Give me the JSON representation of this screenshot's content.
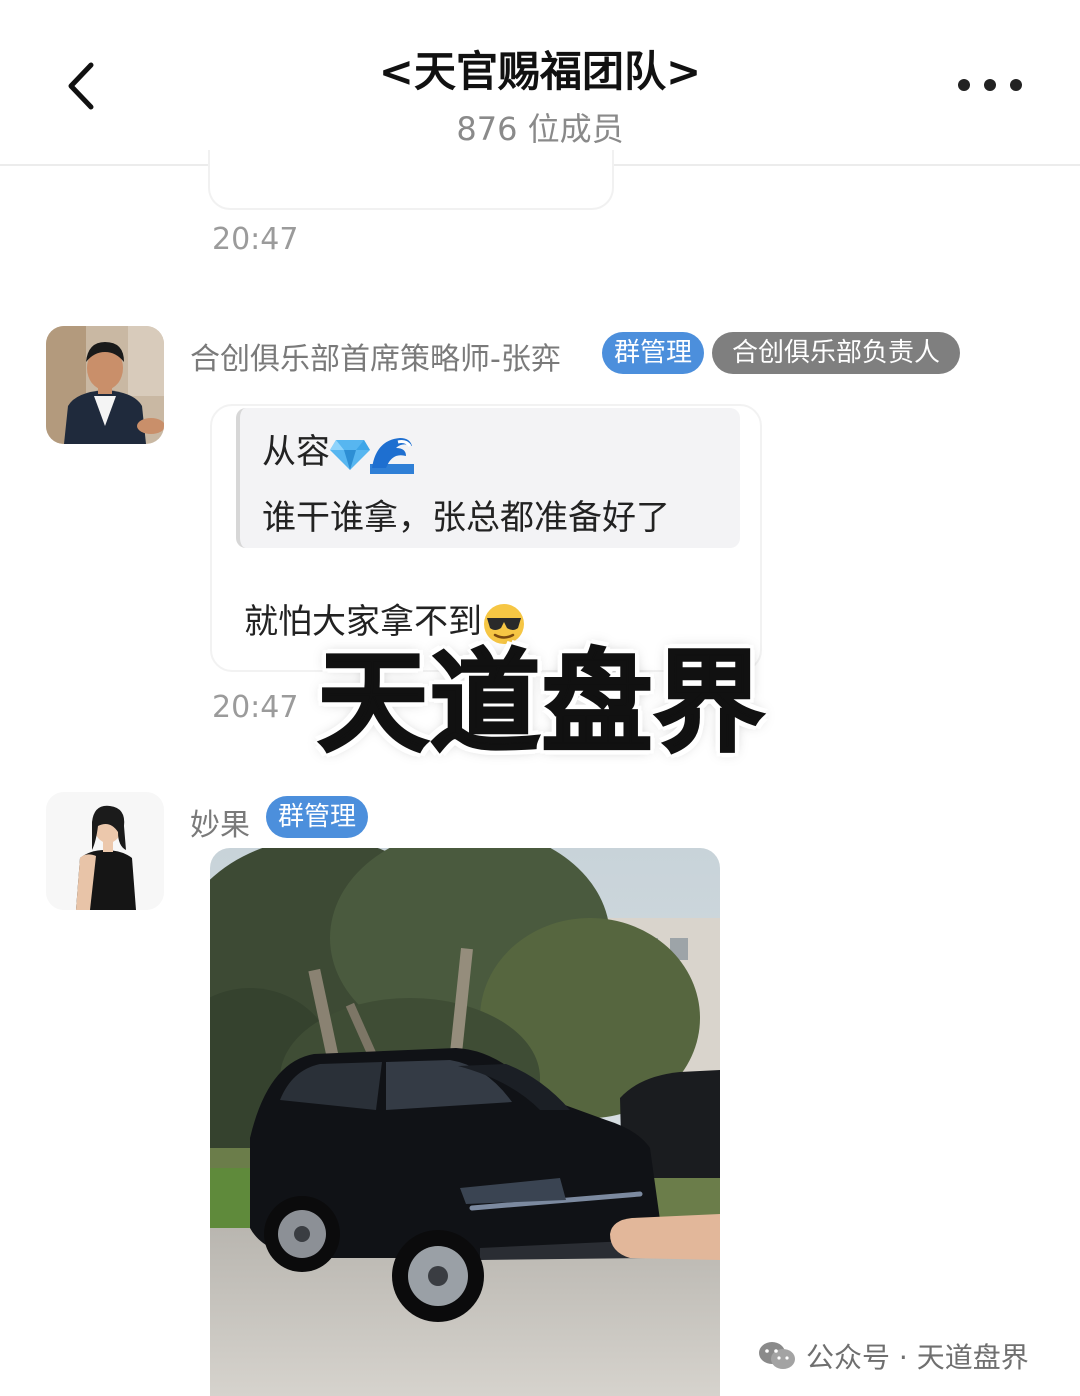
{
  "header": {
    "title": "<天官赐福团队>",
    "member_count": "876 位成员"
  },
  "messages": [
    {
      "time": "20:47"
    },
    {
      "sender": "合创俱乐部首席策略师-张弈",
      "badges": [
        "群管理",
        "合创俱乐部负责人"
      ],
      "quote_author": "从容",
      "quote_text": "谁干谁拿，张总都准备好了",
      "text": "就怕大家拿不到",
      "time": "20:47"
    },
    {
      "sender": "妙果",
      "badges": [
        "群管理"
      ]
    }
  ],
  "overlay": {
    "text": "天道盘界"
  },
  "footer": {
    "text": "公众号 · 天道盘界"
  },
  "colors": {
    "admin_badge": "#4c8fdc",
    "role_badge": "#7f7f7f",
    "time_text": "#9b9b9b"
  }
}
